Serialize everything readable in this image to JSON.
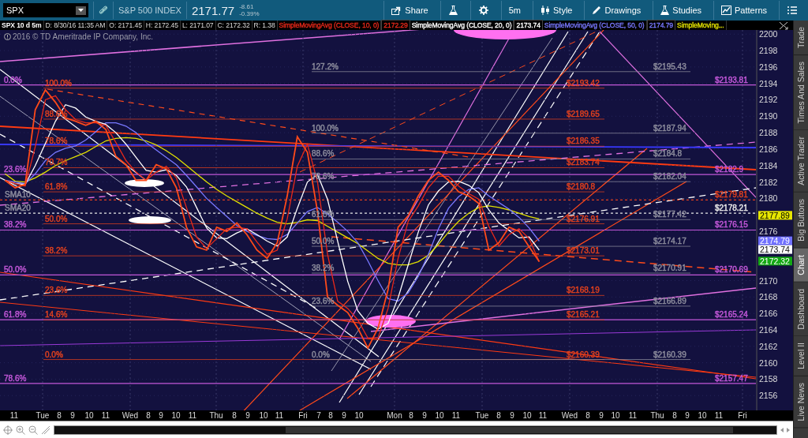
{
  "toolbar": {
    "symbol": "SPX",
    "description": "S&P 500 INDEX",
    "last": "2171.77",
    "change": "-8.61",
    "change_pct": "-0.39%",
    "buttons": [
      "Share",
      "5m",
      "Style",
      "Drawings",
      "Studies",
      "Patterns"
    ]
  },
  "quote_bar": [
    "SPX 10 d 5m",
    "D: 8/30/16 11:35 AM",
    "O: 2171.45",
    "H: 2172.45",
    "L: 2171.07",
    "C: 2172.32",
    "R: 1.38"
  ],
  "study_values": [
    "2172.29",
    "2173.74",
    "2174.79"
  ],
  "copyright": "2016 © TD Ameritrade IP Company, Inc.",
  "chart_data": {
    "type": "line",
    "ylim": [
      2154.2,
      2200.5
    ],
    "grid": true,
    "ref_lines": [
      {
        "axis": "y",
        "value": 2193.81,
        "color": "#c257d8"
      },
      {
        "axis": "y",
        "value": 2182.9,
        "color": "#c257d8"
      },
      {
        "axis": "y",
        "value": 2176.15,
        "color": "#c257d8"
      },
      {
        "axis": "y",
        "value": 2170.69,
        "color": "#c257d8"
      },
      {
        "axis": "y",
        "value": 2165.24,
        "color": "#c257d8"
      },
      {
        "axis": "y",
        "value": 2157.47,
        "color": "#c257d8"
      },
      {
        "axis": "y",
        "value": 2179.81,
        "color": "#e0401e"
      },
      {
        "axis": "y",
        "value": 2178.21,
        "color": "#e8e8e8"
      }
    ],
    "yticks": [
      {
        "value": 2156,
        "label": "2156"
      },
      {
        "value": 2158,
        "label": "2158"
      },
      {
        "value": 2160,
        "label": "2160"
      },
      {
        "value": 2162,
        "label": "2162"
      },
      {
        "value": 2164,
        "label": "2164"
      },
      {
        "value": 2166,
        "label": "2166"
      },
      {
        "value": 2168,
        "label": "2168"
      },
      {
        "value": 2170,
        "label": "2170"
      },
      {
        "value": 2176,
        "label": "2176"
      },
      {
        "value": 2180,
        "label": "2180"
      },
      {
        "value": 2182,
        "label": "2182"
      },
      {
        "value": 2184,
        "label": "2184"
      },
      {
        "value": 2186,
        "label": "2186"
      },
      {
        "value": 2188,
        "label": "2188"
      },
      {
        "value": 2190,
        "label": "2190"
      },
      {
        "value": 2192,
        "label": "2192"
      },
      {
        "value": 2194,
        "label": "2194"
      },
      {
        "value": 2196,
        "label": "2196"
      },
      {
        "value": 2198,
        "label": "2198"
      },
      {
        "value": 2200,
        "label": "2200"
      }
    ],
    "categories": [
      null,
      null,
      null,
      null,
      null,
      null,
      null,
      null,
      null,
      null,
      null,
      null,
      null,
      null,
      null,
      null,
      null,
      null,
      null,
      null,
      null,
      null,
      null,
      null,
      null,
      null,
      null,
      null,
      null,
      null,
      null,
      null,
      null,
      null,
      null,
      null,
      null,
      null,
      null,
      null,
      null,
      null,
      null,
      null,
      null,
      null,
      null,
      null,
      null,
      null,
      null,
      null,
      null,
      null,
      null,
      null,
      null,
      null,
      null,
      null,
      null,
      null,
      null,
      null,
      null,
      null,
      null,
      null,
      null,
      null,
      null,
      null,
      null,
      null,
      null
    ],
    "series": [
      {
        "color": "#ff4a1a",
        "values": [
          2182.2,
          2181.3,
          2181.7,
          2190.8,
          2193.2,
          2191.7,
          2189.8,
          2189.4,
          2188.9,
          2189.4,
          2188.4,
          2185.1,
          2184.1,
          2182.2,
          2182.2,
          2184.1,
          2183.6,
          2181.3,
          2176.5,
          2174.1,
          2173.7,
          2176.5,
          2176.0,
          2177.0,
          2175.6,
          2173.7,
          2172.7,
          2174.6,
          2180.3,
          2187.5,
          2185.6,
          2178.4,
          2168.0,
          2167.0,
          2166.1,
          2164.2,
          2161.8,
          2164.2,
          2168.9,
          2176.5,
          2177.9,
          2180.3,
          2182.2,
          2183.2,
          2182.2,
          2180.8,
          2180.3,
          2179.4,
          2173.7,
          2174.6,
          2176.5,
          2176.0,
          2174.1,
          2172.3,
          null,
          null,
          null,
          null,
          null,
          null,
          null,
          null,
          null,
          null,
          null,
          null,
          null,
          null,
          null,
          null,
          null,
          null,
          null,
          null,
          null
        ]
      },
      {
        "name": "SimpleMovingAvg (CLOSE, 10, 0)",
        "color": "#e8281a",
        "values": [
          2182.2,
          2181.8,
          2181.5,
          2186.3,
          2192.0,
          2192.5,
          2190.8,
          2189.6,
          2189.2,
          2189.2,
          2188.9,
          2186.8,
          2184.6,
          2183.2,
          2182.2,
          2183.2,
          2183.9,
          2182.5,
          2178.9,
          2175.3,
          2173.9,
          2175.1,
          2176.3,
          2176.5,
          2176.3,
          2174.7,
          2173.2,
          2173.7,
          2177.5,
          2183.9,
          2186.6,
          2182.0,
          2173.2,
          2167.5,
          2166.6,
          2165.2,
          2163.0,
          2163.0,
          2166.6,
          2172.7,
          2177.2,
          2179.1,
          2181.3,
          2182.7,
          2182.7,
          2181.5,
          2180.6,
          2179.9,
          2176.6,
          2174.2,
          2175.6,
          2176.3,
          2175.1,
          2172.3,
          null,
          null,
          null,
          null,
          null,
          null,
          null,
          null,
          null,
          null,
          null,
          null,
          null,
          null,
          null,
          null,
          null,
          null,
          null,
          null,
          null
        ]
      },
      {
        "name": "SimpleMovingAvg (CLOSE, 20, 0)",
        "color": "#ffffff",
        "values": [
          2182.2,
          2181.8,
          2181.7,
          2184.0,
          2186.7,
          2189.4,
          2191.4,
          2191.0,
          2189.9,
          2189.4,
          2189.0,
          2188.0,
          2186.6,
          2185.0,
          2183.4,
          2183.2,
          2183.5,
          2182.8,
          2181.4,
          2178.9,
          2176.4,
          2175.2,
          2175.1,
          2175.8,
          2176.3,
          2175.6,
          2174.8,
          2174.2,
          2175.3,
          2178.8,
          2182.0,
          2182.9,
          2179.9,
          2174.8,
          2169.9,
          2166.3,
          2164.8,
          2164.1,
          2164.8,
          2167.9,
          2171.9,
          2175.9,
          2179.2,
          2180.9,
          2182.0,
          2182.1,
          2181.6,
          2180.7,
          2178.6,
          2177.0,
          2176.1,
          2175.2,
          2175.3,
          2173.7,
          null,
          null,
          null,
          null,
          null,
          null,
          null,
          null,
          null,
          null,
          null,
          null,
          null,
          null,
          null,
          null,
          null,
          null,
          null,
          null,
          null
        ]
      },
      {
        "name": "SimpleMovingAvg (CLOSE, 50, 0)",
        "color": "#7878ff",
        "values": [
          2182.2,
          2182.0,
          2181.8,
          2183.0,
          2184.6,
          2185.6,
          2186.1,
          2186.4,
          2187.1,
          2188.1,
          2189.2,
          2189.2,
          2188.8,
          2188.0,
          2186.8,
          2185.9,
          2185.0,
          2184.1,
          2182.8,
          2181.4,
          2180.0,
          2178.9,
          2177.8,
          2176.7,
          2176.0,
          2175.5,
          2175.1,
          2175.0,
          2175.6,
          2177.0,
          2178.4,
          2178.9,
          2178.1,
          2177.1,
          2176.0,
          2174.6,
          2172.4,
          2170.0,
          2167.8,
          2167.5,
          2168.5,
          2170.5,
          2173.2,
          2176.3,
          2178.8,
          2180.2,
          2181.1,
          2181.3,
          2180.3,
          2179.5,
          2178.7,
          2177.7,
          2176.4,
          2174.8,
          null,
          null,
          null,
          null,
          null,
          null,
          null,
          null,
          null,
          null,
          null,
          null,
          null,
          null,
          null,
          null,
          null,
          null,
          null,
          null,
          null
        ]
      },
      {
        "name": "SimpleMoving...",
        "color": "#e0e000",
        "values": [
          2183.0,
          2182.1,
          2182.0,
          2182.5,
          2183.2,
          2184.0,
          2184.6,
          2185.1,
          2185.6,
          2186.3,
          2187.0,
          2187.3,
          2187.4,
          2187.3,
          2187.0,
          2186.5,
          2185.8,
          2185.0,
          2184.0,
          2183.0,
          2182.0,
          2181.1,
          2180.3,
          2179.6,
          2178.9,
          2178.2,
          2177.6,
          2177.1,
          2176.9,
          2177.1,
          2177.4,
          2177.3,
          2176.6,
          2175.9,
          2175.2,
          2174.5,
          2173.6,
          2172.7,
          2172.1,
          2171.9,
          2171.9,
          2172.3,
          2173.1,
          2174.4,
          2175.9,
          2177.2,
          2178.2,
          2178.9,
          2179.1,
          2178.9,
          2178.6,
          2178.2,
          2177.8,
          2177.5,
          null,
          null,
          null,
          null,
          null,
          null,
          null,
          null,
          null,
          null,
          null,
          null,
          null,
          null,
          null,
          null,
          null,
          null,
          null,
          null,
          null
        ]
      }
    ]
  },
  "level_groups": [
    {
      "color": "#c257d8",
      "labels": [
        "0.0%",
        "23.6%",
        "38.2%",
        "50.0%",
        "61.8%",
        "78.6%"
      ]
    },
    {
      "color": "#9090a0",
      "labels": [
        "SMA10",
        "SMA20"
      ]
    },
    {
      "color": "#e0401e",
      "labels": [
        "100.0%",
        "88.6%",
        "78.6%",
        "70.7%",
        "61.8%",
        "50.0%",
        "38.2%",
        "23.6%",
        "14.6%",
        "0.0%"
      ]
    },
    {
      "color": "#8c8c9c",
      "labels": [
        "127.2%",
        "100.0%",
        "88.6%",
        "78.6%",
        "61.8%",
        "50.0%",
        "38.2%",
        "23.6%",
        "0.0%"
      ]
    },
    {
      "color": "#e0401e",
      "labels": [
        "$2193.42",
        "$2189.65",
        "$2186.35",
        "$2183.74",
        "$2180.8",
        "$2176.91",
        "$2173.01",
        "$2168.19",
        "$2165.21",
        "$2160.39"
      ]
    },
    {
      "color": "#8c8c9c",
      "labels": [
        "$2195.43",
        "$2187.94",
        "$2184.8",
        "$2182.04",
        "$2177.42",
        "$2174.17",
        "$2170.91",
        "$2166.89",
        "$2160.39"
      ]
    },
    {
      "color": "#c257d8",
      "labels": [
        "$2193.81",
        "$2182.9",
        "$2176.15",
        "$2170.69",
        "$2165.24",
        "$2157.47"
      ]
    },
    {
      "color": "#e0401e",
      "labels": [
        "$2179.81"
      ]
    },
    {
      "color": "#e8e8e8",
      "labels": [
        "$2178.21"
      ]
    }
  ],
  "axis_badges": [
    {
      "text": "2177.89",
      "color": "#e6e600"
    },
    {
      "text": "2174.79",
      "color": "#7070ff"
    },
    {
      "text": "2173.74",
      "color": "#ffffff"
    },
    {
      "text": "2172.32",
      "color": "#14a814"
    }
  ],
  "time_axis": [
    "11",
    "Tue",
    "8",
    "9",
    "10",
    "11",
    "Wed",
    "8",
    "9",
    "10",
    "11",
    "Thu",
    "8",
    "9",
    "10",
    "11",
    "Fri",
    "7",
    "8",
    "9",
    "10",
    "Mon",
    "8",
    "9",
    "10",
    "11",
    "Tue",
    "8",
    "9",
    "10",
    "11",
    "Wed",
    "8",
    "9",
    "10",
    "11",
    "Thu",
    "8",
    "9",
    "10",
    "11",
    "Fri"
  ],
  "side_tabs": [
    {
      "label": "Trade",
      "selected": false
    },
    {
      "label": "Times And Sales",
      "selected": false
    },
    {
      "label": "Active Trader",
      "selected": false
    },
    {
      "label": "Big Buttons",
      "selected": false
    },
    {
      "label": "Chart",
      "selected": true
    },
    {
      "label": "Dashboard",
      "selected": false
    },
    {
      "label": "Level II",
      "selected": false
    },
    {
      "label": "Live News",
      "selected": false
    }
  ]
}
